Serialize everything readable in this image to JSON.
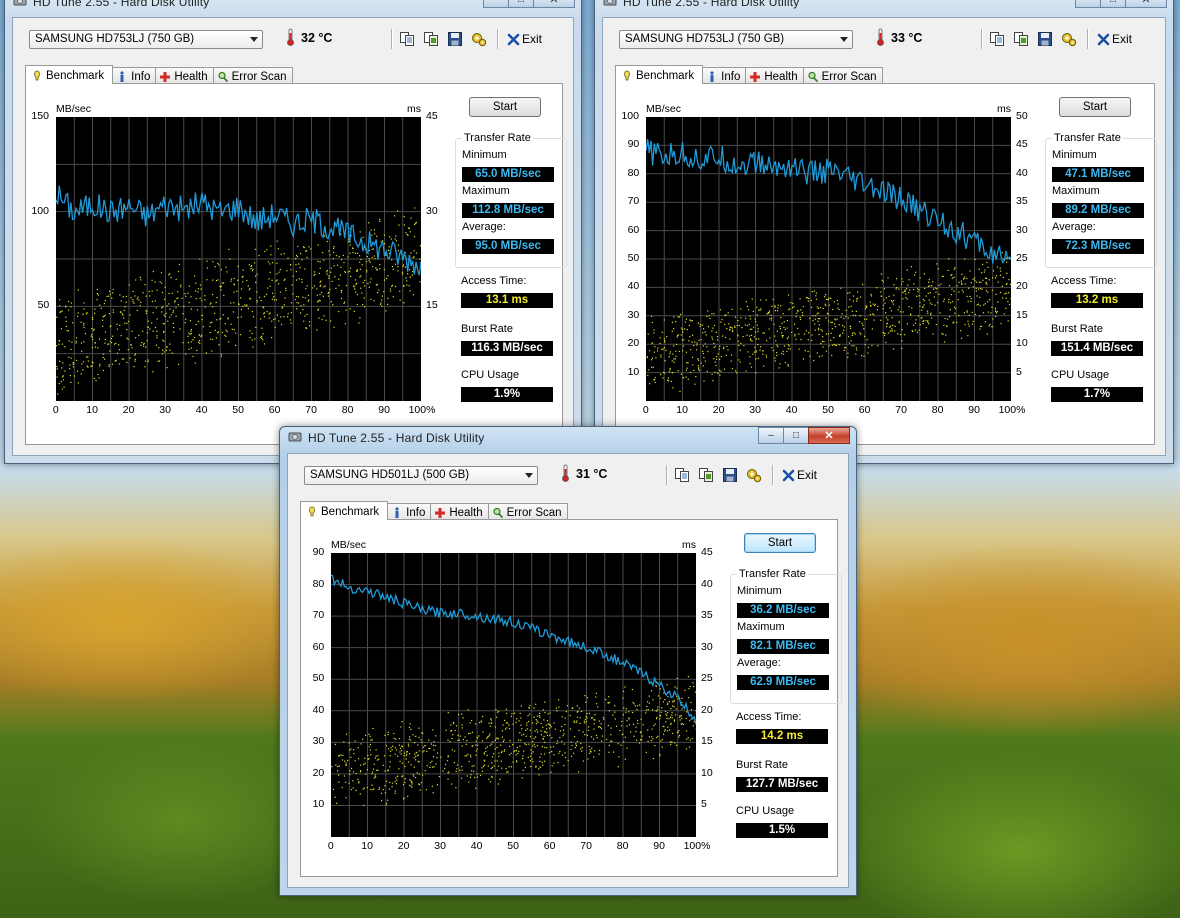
{
  "windows": [
    {
      "title": "HD Tune 2.55 - Hard Disk Utility",
      "drive": "SAMSUNG HD753LJ (750 GB)",
      "temperature": "32 °C",
      "exit_label": "Exit",
      "tabs": [
        "Benchmark",
        "Info",
        "Health",
        "Error Scan"
      ],
      "start_label": "Start",
      "y_unit_left": "MB/sec",
      "y_unit_right": "ms",
      "y_ticks_left": [
        "150",
        "100",
        "50"
      ],
      "y_ticks_right": [
        "45",
        "30",
        "15"
      ],
      "x_ticks": [
        "0",
        "10",
        "20",
        "30",
        "40",
        "50",
        "60",
        "70",
        "80",
        "90",
        "100%"
      ],
      "transfer_rate_title": "Transfer Rate",
      "minimum_label": "Minimum",
      "minimum": "65.0 MB/sec",
      "maximum_label": "Maximum",
      "maximum": "112.8 MB/sec",
      "average_label": "Average:",
      "average": "95.0 MB/sec",
      "access_label": "Access Time:",
      "access": "13.1 ms",
      "burst_label": "Burst Rate",
      "burst": "116.3 MB/sec",
      "cpu_label": "CPU Usage",
      "cpu": "1.9%"
    },
    {
      "title": "HD Tune 2.55 - Hard Disk Utility",
      "drive": "SAMSUNG HD753LJ (750 GB)",
      "temperature": "33 °C",
      "exit_label": "Exit",
      "tabs": [
        "Benchmark",
        "Info",
        "Health",
        "Error Scan"
      ],
      "start_label": "Start",
      "y_unit_left": "MB/sec",
      "y_unit_right": "ms",
      "y_ticks_left": [
        "100",
        "90",
        "80",
        "70",
        "60",
        "50",
        "40",
        "30",
        "20",
        "10"
      ],
      "y_ticks_right": [
        "50",
        "45",
        "40",
        "35",
        "30",
        "25",
        "20",
        "15",
        "10",
        "5"
      ],
      "x_ticks": [
        "0",
        "10",
        "20",
        "30",
        "40",
        "50",
        "60",
        "70",
        "80",
        "90",
        "100%"
      ],
      "transfer_rate_title": "Transfer Rate",
      "minimum_label": "Minimum",
      "minimum": "47.1 MB/sec",
      "maximum_label": "Maximum",
      "maximum": "89.2 MB/sec",
      "average_label": "Average:",
      "average": "72.3 MB/sec",
      "access_label": "Access Time:",
      "access": "13.2 ms",
      "burst_label": "Burst Rate",
      "burst": "151.4 MB/sec",
      "cpu_label": "CPU Usage",
      "cpu": "1.7%"
    },
    {
      "title": "HD Tune 2.55 - Hard Disk Utility",
      "drive": "SAMSUNG HD501LJ (500 GB)",
      "temperature": "31 °C",
      "exit_label": "Exit",
      "tabs": [
        "Benchmark",
        "Info",
        "Health",
        "Error Scan"
      ],
      "start_label": "Start",
      "y_unit_left": "MB/sec",
      "y_unit_right": "ms",
      "y_ticks_left": [
        "90",
        "80",
        "70",
        "60",
        "50",
        "40",
        "30",
        "20",
        "10"
      ],
      "y_ticks_right": [
        "45",
        "40",
        "35",
        "30",
        "25",
        "20",
        "15",
        "10",
        "5"
      ],
      "x_ticks": [
        "0",
        "10",
        "20",
        "30",
        "40",
        "50",
        "60",
        "70",
        "80",
        "90",
        "100%"
      ],
      "transfer_rate_title": "Transfer Rate",
      "minimum_label": "Minimum",
      "minimum": "36.2 MB/sec",
      "maximum_label": "Maximum",
      "maximum": "82.1 MB/sec",
      "average_label": "Average:",
      "average": "62.9 MB/sec",
      "access_label": "Access Time:",
      "access": "14.2 ms",
      "burst_label": "Burst Rate",
      "burst": "127.7 MB/sec",
      "cpu_label": "CPU Usage",
      "cpu": "1.5%"
    }
  ],
  "chart_data": [
    {
      "type": "line",
      "x": [
        0,
        5,
        10,
        15,
        20,
        25,
        30,
        35,
        40,
        45,
        50,
        55,
        60,
        65,
        70,
        75,
        80,
        85,
        90,
        95,
        100
      ],
      "series": [
        {
          "values": [
            110,
            100,
            104,
            100,
            103,
            98,
            104,
            101,
            105,
            100,
            103,
            95,
            99,
            94,
            96,
            92,
            88,
            84,
            80,
            76,
            72
          ]
        }
      ],
      "access_time_scatter": {
        "x_range": [
          0,
          100
        ],
        "ms_start": 9,
        "ms_end": 23
      },
      "xlim": [
        0,
        100
      ],
      "ylim": [
        0,
        150
      ],
      "y2lim": [
        0,
        45
      ],
      "colors": {
        "series": "#1e9bd8",
        "scatter": "#e3e02a",
        "background": "#000000",
        "grid": "#4a4a4a"
      }
    },
    {
      "type": "line",
      "x": [
        0,
        5,
        10,
        15,
        20,
        25,
        30,
        35,
        40,
        45,
        50,
        55,
        60,
        65,
        70,
        75,
        80,
        85,
        90,
        95,
        100
      ],
      "series": [
        {
          "values": [
            88,
            86,
            87,
            85,
            86,
            83,
            84,
            82,
            83,
            80,
            81,
            78,
            76,
            73,
            71,
            67,
            64,
            60,
            56,
            52,
            47
          ]
        }
      ],
      "access_time_scatter": {
        "x_range": [
          0,
          100
        ],
        "ms_start": 8,
        "ms_end": 20
      },
      "xlim": [
        0,
        100
      ],
      "ylim": [
        0,
        100
      ],
      "y2lim": [
        0,
        50
      ],
      "colors": {
        "series": "#1e9bd8",
        "scatter": "#e3e02a",
        "background": "#000000",
        "grid": "#4a4a4a"
      }
    },
    {
      "type": "line",
      "x": [
        0,
        5,
        10,
        15,
        20,
        25,
        30,
        35,
        40,
        45,
        50,
        55,
        60,
        65,
        70,
        75,
        80,
        85,
        90,
        95,
        100
      ],
      "series": [
        {
          "values": [
            82,
            79,
            78,
            76,
            74,
            72,
            71,
            71,
            70,
            69,
            68,
            66,
            64,
            62,
            60,
            58,
            55,
            52,
            48,
            44,
            37
          ]
        }
      ],
      "access_time_scatter": {
        "x_range": [
          0,
          100
        ],
        "ms_start": 10,
        "ms_end": 20
      },
      "xlim": [
        0,
        100
      ],
      "ylim": [
        0,
        90
      ],
      "y2lim": [
        0,
        45
      ],
      "colors": {
        "series": "#1e9bd8",
        "scatter": "#e3e02a",
        "background": "#000000",
        "grid": "#4a4a4a"
      }
    }
  ]
}
